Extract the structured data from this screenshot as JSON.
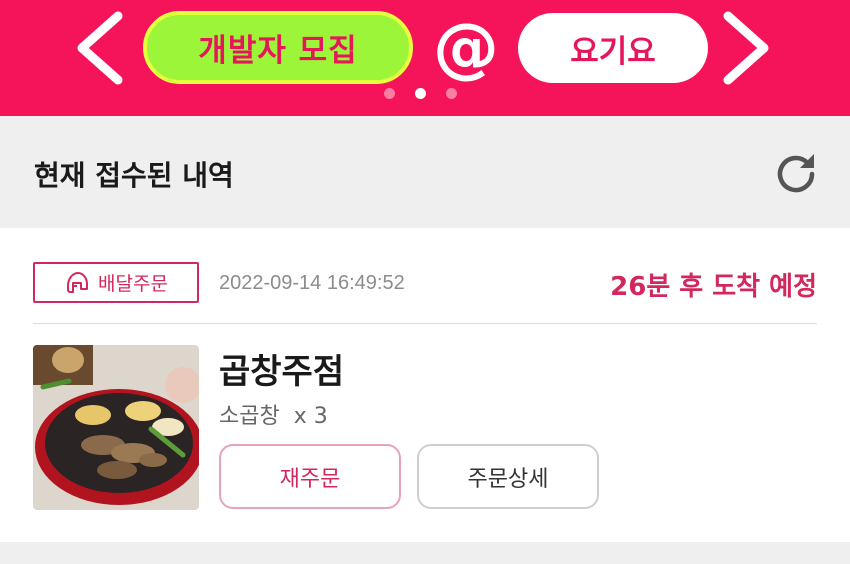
{
  "banner": {
    "recruit_label": "개발자 모집",
    "at_symbol": "@",
    "brand_label": "요기요",
    "page_count": 3,
    "active_page": 2,
    "colors": {
      "background": "#f5145a",
      "recruit_pill": "#9df53a",
      "brand_text": "#e5175b"
    }
  },
  "section": {
    "title": "현재 접수된 내역"
  },
  "order": {
    "type_label": "배달주문",
    "timestamp": "2022-09-14 16:49:52",
    "eta": "26분 후 도착 예정",
    "store_name": "곱창주점",
    "menu_item": "소곱창",
    "menu_quantity": "x 3",
    "reorder_label": "재주문",
    "detail_label": "주문상세",
    "colors": {
      "accent": "#d2285d"
    }
  },
  "icons": {
    "prev": "chevron-left-icon",
    "next": "chevron-right-icon",
    "refresh": "refresh-icon",
    "delivery": "delivery-helmet-icon"
  }
}
